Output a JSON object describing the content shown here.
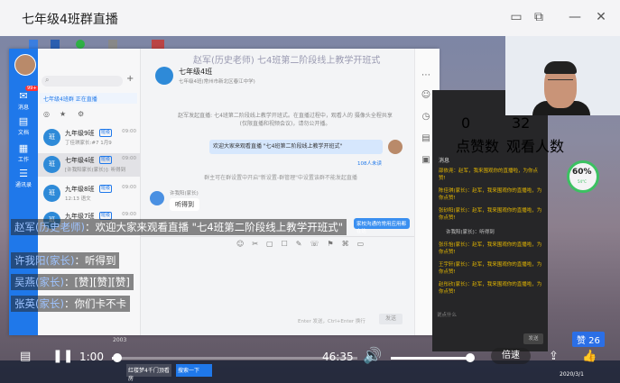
{
  "window": {
    "title": "七年级4班群直播"
  },
  "im": {
    "header_name": "赵军(历史老师) 七4班第二阶段线上教学开班式",
    "group_title": "七年级4班",
    "group_sub": "七年级4班(常州市新北区春江中学)",
    "live_banner": "七年级4班群 正在直播",
    "rail": [
      {
        "label": "消息",
        "badge": "99+"
      },
      {
        "label": "文档"
      },
      {
        "label": "工作"
      },
      {
        "label": "通讯录"
      }
    ],
    "chats": [
      {
        "name": "九年级9班",
        "sub": "丁佳琪家长:#7 1月9",
        "time": "09:00",
        "tag": "班级"
      },
      {
        "name": "七年级4班",
        "sub": "[许我阳家长(家长)]: 听得到",
        "time": "09:00",
        "tag": "班级"
      },
      {
        "name": "九年级8班",
        "sub": "12:13 语文",
        "time": "09:00",
        "tag": "班级"
      },
      {
        "name": "九年级7班",
        "sub": "",
        "time": "09:00",
        "tag": "班级"
      }
    ],
    "sys_notice": "赵军发起直播: 七4班第二阶段线上教学开班式。在直播过程中，观看人的 摄像头全程共享(仅限直播和视频会议)，请勿公开播。",
    "welcome": "欢迎大家来观看直播 \"七4班第二阶段线上教学开班式\"",
    "read_count": "108人未读",
    "notice2": "群主可在群设置中开启\"新设置-群管理\"中设置该群不能发起直播",
    "student_name": "许我阳(家长)",
    "student_msg": "听得到",
    "hint_btn": "家校沟通的常用应用都在这",
    "input_placeholder": "Enter 发送，Ctrl+Enter 换行",
    "send": "发送"
  },
  "live": {
    "likes": "0",
    "likes_label": "点赞数",
    "viewers": "32",
    "viewers_label": "观看人数",
    "msg_title": "消息",
    "messages": [
      "邵依尧：赵军，我来围观你的直播啦，为你点赞!",
      "陈佳琪(家长)：赵军，我来围观你的直播啦，为你点赞!",
      "张砂阳(家长)：赵军，我来围观你的直播啦，为你点赞!",
      "许我阳(家长)：听得到",
      "张乐怡(家长)：赵军，我来围观你的直播啦，为你点赞!",
      "王宇轩(家长)：赵军，我来围观你的直播啦，为你点赞!",
      "赵彤欣(家长)：赵军，我来围观你的直播啦，为你点赞!"
    ],
    "input_hint": "说点什么",
    "send": "发送"
  },
  "perf": {
    "percent": "60%",
    "sub": "54°C"
  },
  "comments": [
    {
      "name": "赵军(历史老师)",
      "text": "：欢迎大家来观看直播 \"七4班第二阶段线上教学开班式\""
    },
    {
      "name": "许我阳(家长)",
      "text": "：听得到"
    },
    {
      "name": "吴燕(家长)",
      "text": "：[赞][赞][赞]"
    },
    {
      "name": "张英(家长)",
      "text": "：你们卡不卡"
    }
  ],
  "player": {
    "current_time": "1:00",
    "total_time": "46:35",
    "progress": 0.021,
    "volume": 1.0,
    "speed_label": "倍速",
    "likes_badge": "赞 26",
    "year": "2003",
    "date": "2020/3/1"
  },
  "taskbar": {
    "app1": "红楼梦4千门顶看房",
    "app2": "搜索一下"
  },
  "colors": {
    "accent": "#1f78ea",
    "live_bg": "#262628",
    "msg_yellow": "#e6b800"
  }
}
